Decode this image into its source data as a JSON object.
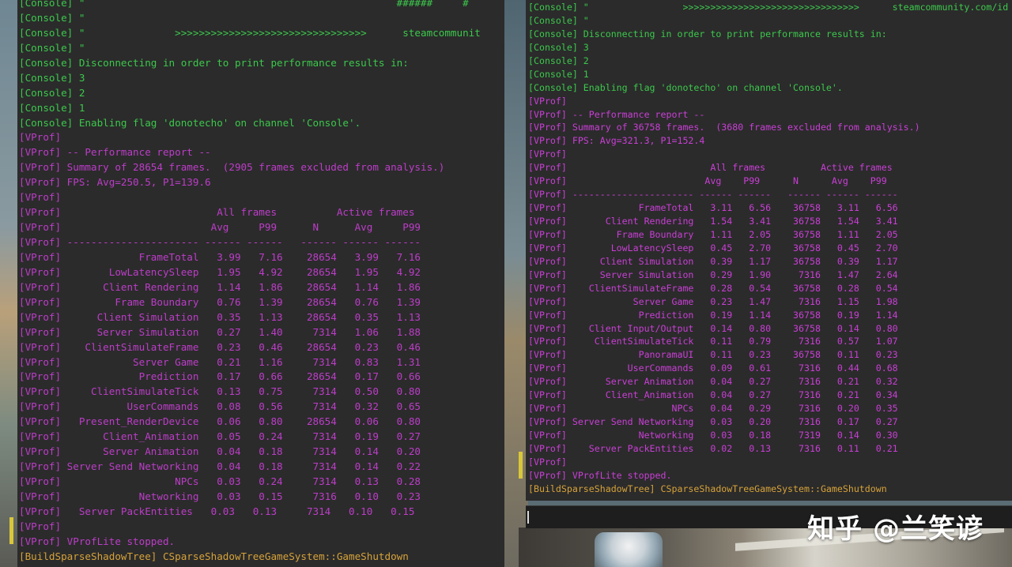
{
  "left_console": {
    "lines": [
      {
        "t": "[Console] \"                                                    ######     #",
        "c": "g"
      },
      {
        "t": "[Console] \"",
        "c": "g"
      },
      {
        "t": "[Console] \"               >>>>>>>>>>>>>>>>>>>>>>>>>>>>>>>>      steamcommunit",
        "c": "g"
      },
      {
        "t": "[Console] \"",
        "c": "g"
      },
      {
        "t": "[Console] Disconnecting in order to print performance results in:",
        "c": "g"
      },
      {
        "t": "[Console] 3",
        "c": "g"
      },
      {
        "t": "[Console] 2",
        "c": "g"
      },
      {
        "t": "[Console] 1",
        "c": "g"
      },
      {
        "t": "[Console] Enabling flag 'donotecho' on channel 'Console'.",
        "c": "g"
      },
      {
        "t": "[VProf]",
        "c": "p"
      },
      {
        "t": "[VProf] -- Performance report --",
        "c": "p"
      },
      {
        "t": "[VProf] Summary of 28654 frames.  (2905 frames excluded from analysis.)",
        "c": "p"
      },
      {
        "t": "[VProf] FPS: Avg=250.5, P1=139.6",
        "c": "p"
      },
      {
        "t": "[VProf]",
        "c": "p"
      },
      {
        "t": "[VProf]                          All frames          Active frames",
        "c": "p"
      },
      {
        "t": "[VProf]                         Avg     P99      N      Avg     P99",
        "c": "p"
      },
      {
        "t": "[VProf] ---------------------- ------ ------   ------ ------ ------",
        "c": "p"
      },
      {
        "t": "[VProf]             FrameTotal   3.99   7.16    28654   3.99   7.16",
        "c": "p"
      },
      {
        "t": "[VProf]        LowLatencySleep   1.95   4.92    28654   1.95   4.92",
        "c": "p"
      },
      {
        "t": "[VProf]       Client Rendering   1.14   1.86    28654   1.14   1.86",
        "c": "p"
      },
      {
        "t": "[VProf]         Frame Boundary   0.76   1.39    28654   0.76   1.39",
        "c": "p"
      },
      {
        "t": "[VProf]      Client Simulation   0.35   1.13    28654   0.35   1.13",
        "c": "p"
      },
      {
        "t": "[VProf]      Server Simulation   0.27   1.40     7314   1.06   1.88",
        "c": "p"
      },
      {
        "t": "[VProf]    ClientSimulateFrame   0.23   0.46    28654   0.23   0.46",
        "c": "p"
      },
      {
        "t": "[VProf]            Server Game   0.21   1.16     7314   0.83   1.31",
        "c": "p"
      },
      {
        "t": "[VProf]             Prediction   0.17   0.66    28654   0.17   0.66",
        "c": "p"
      },
      {
        "t": "[VProf]     ClientSimulateTick   0.13   0.75     7314   0.50   0.80",
        "c": "p"
      },
      {
        "t": "[VProf]           UserCommands   0.08   0.56     7314   0.32   0.65",
        "c": "p"
      },
      {
        "t": "[VProf]   Present_RenderDevice   0.06   0.80    28654   0.06   0.80",
        "c": "p"
      },
      {
        "t": "[VProf]       Client_Animation   0.05   0.24     7314   0.19   0.27",
        "c": "p"
      },
      {
        "t": "[VProf]       Server Animation   0.04   0.18     7314   0.14   0.20",
        "c": "p"
      },
      {
        "t": "[VProf] Server Send Networking   0.04   0.18     7314   0.14   0.22",
        "c": "p"
      },
      {
        "t": "[VProf]                   NPCs   0.03   0.24     7314   0.13   0.28",
        "c": "p"
      },
      {
        "t": "[VProf]             Networking   0.03   0.15     7316   0.10   0.23",
        "c": "p"
      },
      {
        "t": "[VProf]   Server PackEntities   0.03   0.13     7314   0.10   0.15",
        "c": "p"
      },
      {
        "t": "[VProf]",
        "c": "p"
      },
      {
        "t": "[VProf] VProfLite stopped.",
        "c": "p"
      },
      {
        "t": "[BuildSparseShadowTree] CSparseShadowTreeGameSystem::GameShutdown",
        "c": "o"
      }
    ]
  },
  "right_console": {
    "lines": [
      {
        "t": "[Console] \"                 >>>>>>>>>>>>>>>>>>>>>>>>>>>>>>>>      steamcommunity.com/id",
        "c": "g"
      },
      {
        "t": "[Console] \"",
        "c": "g"
      },
      {
        "t": "[Console] Disconnecting in order to print performance results in:",
        "c": "g"
      },
      {
        "t": "[Console] 3",
        "c": "g"
      },
      {
        "t": "[Console] 2",
        "c": "g"
      },
      {
        "t": "[Console] 1",
        "c": "g"
      },
      {
        "t": "[Console] Enabling flag 'donotecho' on channel 'Console'.",
        "c": "g"
      },
      {
        "t": "[VProf]",
        "c": "p"
      },
      {
        "t": "[VProf] -- Performance report --",
        "c": "p"
      },
      {
        "t": "[VProf] Summary of 36758 frames.  (3680 frames excluded from analysis.)",
        "c": "p"
      },
      {
        "t": "[VProf] FPS: Avg=321.3, P1=152.4",
        "c": "p"
      },
      {
        "t": "[VProf]",
        "c": "p"
      },
      {
        "t": "[VProf]                          All frames          Active frames",
        "c": "p"
      },
      {
        "t": "[VProf]                         Avg    P99      N      Avg    P99",
        "c": "p"
      },
      {
        "t": "[VProf] ---------------------- ------ ------   ------ ------ ------",
        "c": "p"
      },
      {
        "t": "[VProf]             FrameTotal   3.11   6.56    36758   3.11   6.56",
        "c": "p"
      },
      {
        "t": "[VProf]       Client Rendering   1.54   3.41    36758   1.54   3.41",
        "c": "p"
      },
      {
        "t": "[VProf]         Frame Boundary   1.11   2.05    36758   1.11   2.05",
        "c": "p"
      },
      {
        "t": "[VProf]        LowLatencySleep   0.45   2.70    36758   0.45   2.70",
        "c": "p"
      },
      {
        "t": "[VProf]      Client Simulation   0.39   1.17    36758   0.39   1.17",
        "c": "p"
      },
      {
        "t": "[VProf]      Server Simulation   0.29   1.90     7316   1.47   2.64",
        "c": "p"
      },
      {
        "t": "[VProf]    ClientSimulateFrame   0.28   0.54    36758   0.28   0.54",
        "c": "p"
      },
      {
        "t": "[VProf]            Server Game   0.23   1.47     7316   1.15   1.98",
        "c": "p"
      },
      {
        "t": "[VProf]             Prediction   0.19   1.14    36758   0.19   1.14",
        "c": "p"
      },
      {
        "t": "[VProf]    Client Input/Output   0.14   0.80    36758   0.14   0.80",
        "c": "p"
      },
      {
        "t": "[VProf]     ClientSimulateTick   0.11   0.79     7316   0.57   1.07",
        "c": "p"
      },
      {
        "t": "[VProf]             PanoramaUI   0.11   0.23    36758   0.11   0.23",
        "c": "p"
      },
      {
        "t": "[VProf]           UserCommands   0.09   0.61     7316   0.44   0.68",
        "c": "p"
      },
      {
        "t": "[VProf]       Server Animation   0.04   0.27     7316   0.21   0.32",
        "c": "p"
      },
      {
        "t": "[VProf]       Client_Animation   0.04   0.27     7316   0.21   0.34",
        "c": "p"
      },
      {
        "t": "[VProf]                   NPCs   0.04   0.29     7316   0.20   0.35",
        "c": "p"
      },
      {
        "t": "[VProf] Server Send Networking   0.03   0.20     7316   0.17   0.27",
        "c": "p"
      },
      {
        "t": "[VProf]             Networking   0.03   0.18     7319   0.14   0.30",
        "c": "p"
      },
      {
        "t": "[VProf]    Server PackEntities   0.02   0.13     7316   0.11   0.21",
        "c": "p"
      },
      {
        "t": "[VProf]",
        "c": "p"
      },
      {
        "t": "[VProf] VProfLite stopped.",
        "c": "p"
      },
      {
        "t": "[BuildSparseShadowTree] CSparseShadowTreeGameSystem::GameShutdown",
        "c": "o"
      }
    ]
  },
  "console_input": {
    "value": ""
  },
  "watermark": "知乎 @兰笑谚",
  "colors": {
    "console_green": "#3cc84c",
    "vprof_magenta": "#c93fd6",
    "shadow_orange": "#d6a23a"
  }
}
